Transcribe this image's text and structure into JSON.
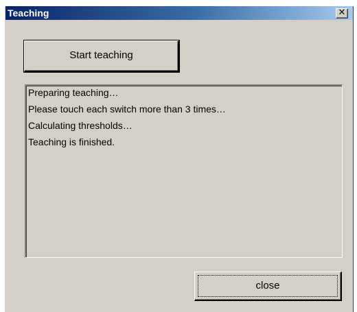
{
  "window": {
    "title": "Teaching",
    "close_glyph": "✕",
    "close_icon": "close-icon"
  },
  "start_button": {
    "label": "Start teaching"
  },
  "log": {
    "lines": [
      "Preparing teaching…",
      "Please touch each switch more than 3 times…",
      "Calculating thresholds…",
      "Teaching is finished."
    ]
  },
  "close_button": {
    "label": "close",
    "focused": true
  },
  "colors": {
    "face": "#d4d0c8",
    "title_start": "#0a246a",
    "title_end": "#a6caf0"
  }
}
